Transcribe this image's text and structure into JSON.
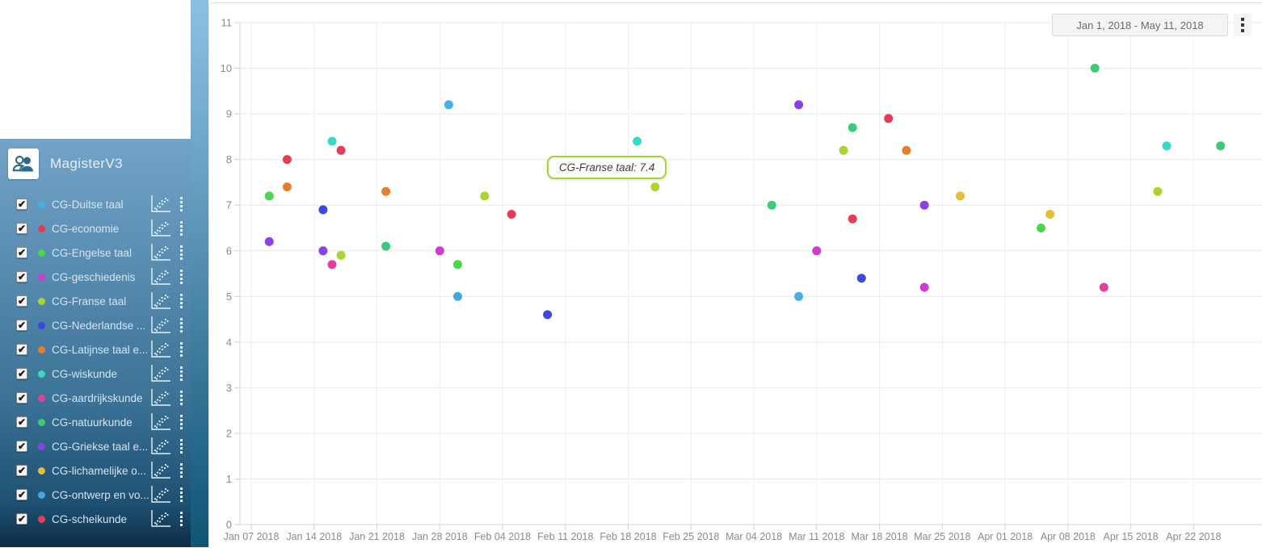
{
  "sidebar": {
    "app_title": "MagisterV3",
    "items": [
      {
        "label": "CG-Duitse taal",
        "color": "#4aaee6",
        "checked": true
      },
      {
        "label": "CG-economie",
        "color": "#e43d52",
        "checked": true
      },
      {
        "label": "CG-Engelse taal",
        "color": "#47d84c",
        "checked": true
      },
      {
        "label": "CG-geschiedenis",
        "color": "#d23ad2",
        "checked": true
      },
      {
        "label": "CG-Franse taal",
        "color": "#abd430",
        "checked": true
      },
      {
        "label": "CG-Nederlandse ...",
        "color": "#3c49e0",
        "checked": true
      },
      {
        "label": "CG-Latijnse taal e...",
        "color": "#e57f2d",
        "checked": true
      },
      {
        "label": "CG-wiskunde",
        "color": "#35dcc3",
        "checked": true
      },
      {
        "label": "CG-aardrijkskunde",
        "color": "#e53e9c",
        "checked": true
      },
      {
        "label": "CG-natuurkunde",
        "color": "#3bcb78",
        "checked": true
      },
      {
        "label": "CG-Griekse taal e...",
        "color": "#8a42e8",
        "checked": true
      },
      {
        "label": "CG-lichamelijke o...",
        "color": "#e6bd35",
        "checked": true
      },
      {
        "label": "CG-ontwerp en vo...",
        "color": "#43a7e0",
        "checked": true
      },
      {
        "label": "CG-scheikunde",
        "color": "#e63c5c",
        "checked": true
      }
    ]
  },
  "chart": {
    "date_range_label": "Jan 1, 2018 - May 11, 2018",
    "tooltip": {
      "text": "CG-Franse taal: 7.4",
      "series": "CG-Franse taal",
      "date": "2018-02-21",
      "value": 7.4
    }
  },
  "chart_data": {
    "type": "scatter",
    "title": "",
    "xlabel": "",
    "ylabel": "",
    "x_axis": {
      "start_date": "2018-01-07",
      "tick_interval_days": 7,
      "tick_labels": [
        "Jan 07 2018",
        "Jan 14 2018",
        "Jan 21 2018",
        "Jan 28 2018",
        "Feb 04 2018",
        "Feb 11 2018",
        "Feb 18 2018",
        "Feb 25 2018",
        "Mar 04 2018",
        "Mar 11 2018",
        "Mar 18 2018",
        "Mar 25 2018",
        "Apr 01 2018",
        "Apr 08 2018",
        "Apr 15 2018",
        "Apr 22 2018"
      ]
    },
    "y_axis": {
      "min": 0,
      "max": 11,
      "tick_step": 1
    },
    "grid": true,
    "series": [
      {
        "name": "CG-Duitse taal",
        "color": "#4aaee6",
        "points": [
          [
            "2018-01-29",
            9.2
          ],
          [
            "2018-03-09",
            5.0
          ]
        ]
      },
      {
        "name": "CG-economie",
        "color": "#e43d52",
        "points": [
          [
            "2018-01-11",
            8.0
          ],
          [
            "2018-02-05",
            6.8
          ],
          [
            "2018-03-19",
            8.9
          ]
        ]
      },
      {
        "name": "CG-Engelse taal",
        "color": "#47d84c",
        "points": [
          [
            "2018-01-09",
            7.2
          ],
          [
            "2018-01-30",
            5.7
          ],
          [
            "2018-04-05",
            6.5
          ]
        ]
      },
      {
        "name": "CG-geschiedenis",
        "color": "#d23ad2",
        "points": [
          [
            "2018-01-28",
            6.0
          ],
          [
            "2018-03-11",
            6.0
          ],
          [
            "2018-03-23",
            5.2
          ]
        ]
      },
      {
        "name": "CG-Franse taal",
        "color": "#abd430",
        "points": [
          [
            "2018-01-17",
            5.9
          ],
          [
            "2018-02-02",
            7.2
          ],
          [
            "2018-02-21",
            7.4
          ],
          [
            "2018-03-14",
            8.2
          ],
          [
            "2018-04-18",
            7.3
          ]
        ]
      },
      {
        "name": "CG-Nederlandse ...",
        "color": "#3c49e0",
        "points": [
          [
            "2018-01-15",
            6.9
          ],
          [
            "2018-02-09",
            4.6
          ],
          [
            "2018-03-16",
            5.4
          ]
        ]
      },
      {
        "name": "CG-Latijnse taal e...",
        "color": "#e57f2d",
        "points": [
          [
            "2018-01-11",
            7.4
          ],
          [
            "2018-01-22",
            7.3
          ],
          [
            "2018-03-21",
            8.2
          ]
        ]
      },
      {
        "name": "CG-wiskunde",
        "color": "#35dcc3",
        "points": [
          [
            "2018-01-16",
            8.4
          ],
          [
            "2018-02-19",
            8.4
          ],
          [
            "2018-04-19",
            8.3
          ]
        ]
      },
      {
        "name": "CG-aardrijkskunde",
        "color": "#e53e9c",
        "points": [
          [
            "2018-01-16",
            5.7
          ],
          [
            "2018-04-12",
            5.2
          ]
        ]
      },
      {
        "name": "CG-natuurkunde",
        "color": "#3bcb78",
        "points": [
          [
            "2018-01-22",
            6.1
          ],
          [
            "2018-03-06",
            7.0
          ],
          [
            "2018-03-15",
            8.7
          ],
          [
            "2018-04-11",
            10.0
          ],
          [
            "2018-04-25",
            8.3
          ]
        ]
      },
      {
        "name": "CG-Griekse taal e...",
        "color": "#8a42e8",
        "points": [
          [
            "2018-01-09",
            6.2
          ],
          [
            "2018-01-15",
            6.0
          ],
          [
            "2018-03-09",
            9.2
          ],
          [
            "2018-03-23",
            7.0
          ]
        ]
      },
      {
        "name": "CG-lichamelijke o...",
        "color": "#e6bd35",
        "points": [
          [
            "2018-03-27",
            7.2
          ],
          [
            "2018-04-06",
            6.8
          ]
        ]
      },
      {
        "name": "CG-ontwerp en vo...",
        "color": "#43a7e0",
        "points": [
          [
            "2018-01-30",
            5.0
          ]
        ]
      },
      {
        "name": "CG-scheikunde",
        "color": "#e63c5c",
        "points": [
          [
            "2018-01-17",
            8.2
          ],
          [
            "2018-03-15",
            6.7
          ]
        ]
      }
    ]
  }
}
